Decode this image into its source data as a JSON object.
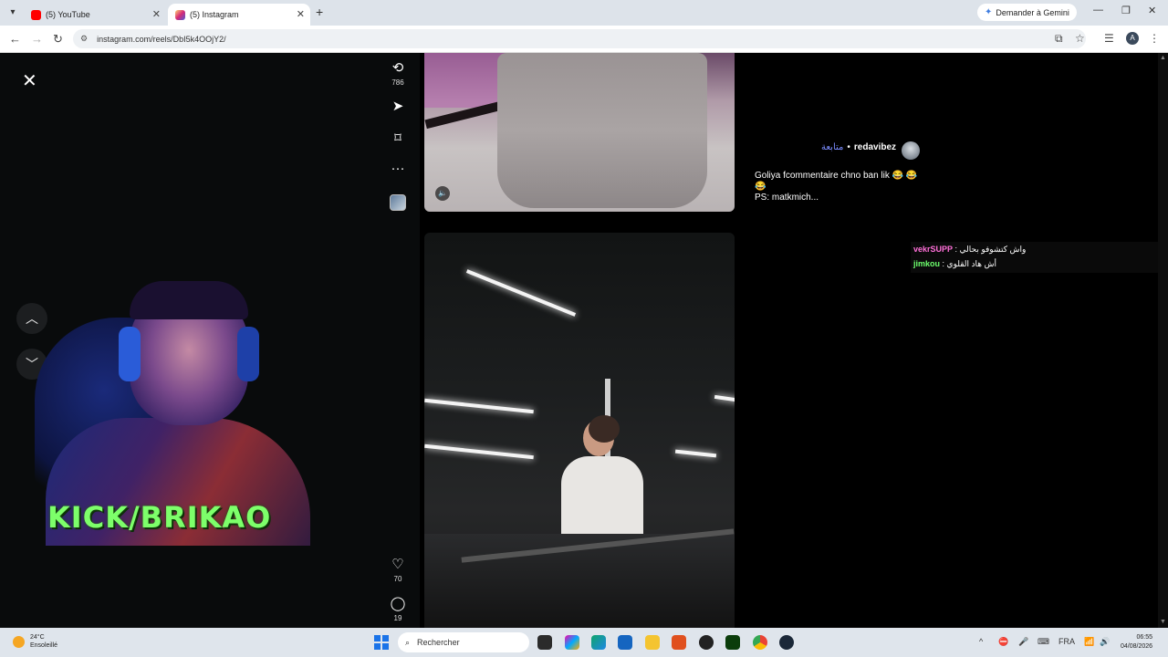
{
  "browser": {
    "tabs": [
      {
        "title": "(5) YouTube",
        "active": false,
        "favicon_color": "#ff0000"
      },
      {
        "title": "(5) Instagram",
        "active": true,
        "favicon_color": "#e1306c"
      }
    ],
    "gemini_label": "Demander à Gemini",
    "url": "instagram.com/reels/DbI5k4OOjY2/",
    "profile_initial": "A"
  },
  "reel_actions_top": {
    "repost_count": "786"
  },
  "reel_actions_bottom": {
    "like_count": "70",
    "comment_count": "19"
  },
  "caption": {
    "username": "redavibez",
    "follow_label": "متابعة",
    "text_line1": "Goliya fcommentaire chno ban lik 😂 😂",
    "text_line2": "😂",
    "text_line3": "PS: matkmich..."
  },
  "chat": [
    {
      "user": "vekrSUPP",
      "user_color": "#ff6fd8",
      "message": " : واش كتشوفو بحالي"
    },
    {
      "user": "jimkou",
      "user_color": "#6dff6d",
      "message": " : أش هاد القلوي"
    }
  ],
  "overlay": {
    "brand_text": "KICK/BRIKAO"
  },
  "taskbar": {
    "weather_temp": "24°C",
    "weather_desc": "Ensoleillé",
    "search_placeholder": "Rechercher",
    "lang": "FRA",
    "time": "06:55",
    "date": "04/08/2026"
  },
  "icons": {
    "close": "close-icon",
    "up": "chevron-up-icon",
    "down": "chevron-down-icon",
    "repost": "repost-icon",
    "share": "send-icon",
    "save": "bookmark-icon",
    "more": "more-icon",
    "like": "heart-icon",
    "comment": "comment-icon"
  }
}
